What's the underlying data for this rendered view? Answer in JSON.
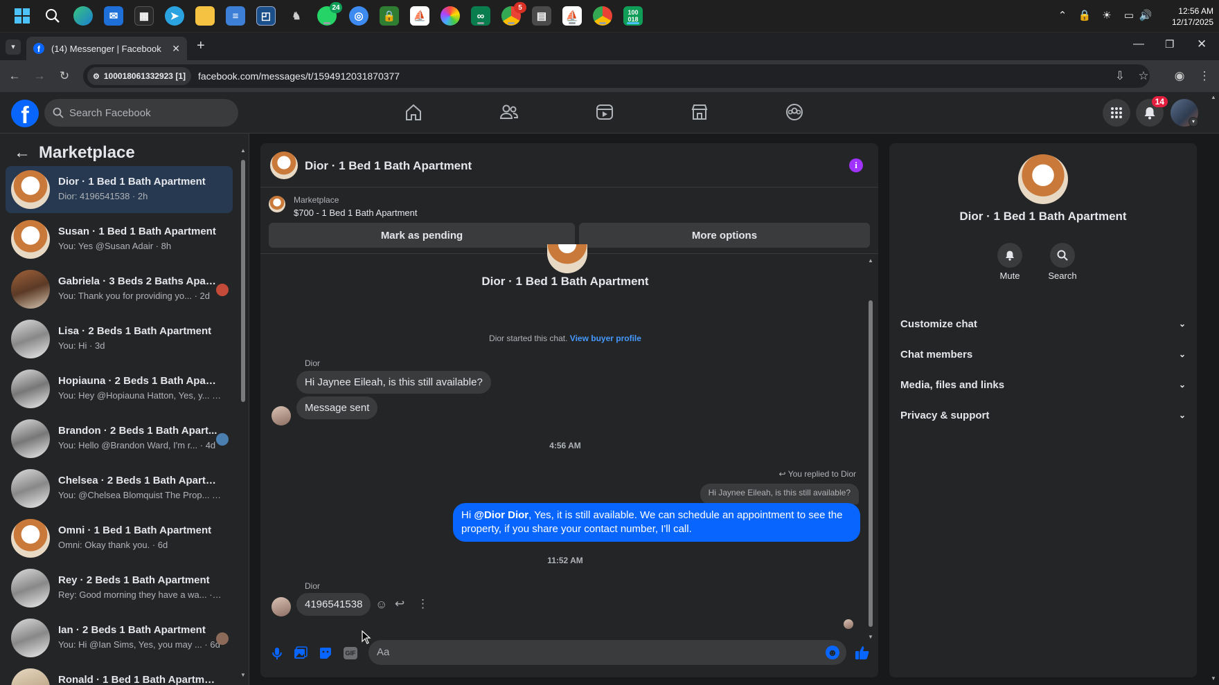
{
  "taskbar": {
    "whatsapp_badge": "24",
    "chrome_badge": "5",
    "clock_time": "12:56 AM",
    "clock_date": "12/17/2025",
    "app_badge_label": "100\n018"
  },
  "browser": {
    "tab_title": "(14) Messenger | Facebook",
    "site_chip": "100018061332923 [1]",
    "url": "facebook.com/messages/t/1594912031870377"
  },
  "fb": {
    "search_placeholder": "Search Facebook",
    "notifications_count": "14"
  },
  "sidebar": {
    "title": "Marketplace",
    "conversations": [
      {
        "title": "Dior · 1 Bed 1 Bath Apartment",
        "subtitle": "Dior: 4196541538 · 2h"
      },
      {
        "title": "Susan · 1 Bed 1 Bath Apartment",
        "subtitle": "You: Yes @Susan Adair · 8h"
      },
      {
        "title": "Gabriela · 3 Beds 2 Baths Apar...",
        "subtitle": "You: Thank you for providing yo...  · 2d"
      },
      {
        "title": "Lisa · 2 Beds 1 Bath Apartment",
        "subtitle": "You: Hi · 3d"
      },
      {
        "title": "Hopiauna · 2 Beds 1 Bath Apart...",
        "subtitle": "You: Hey @Hopiauna Hatton, Yes, y... · 4d"
      },
      {
        "title": "Brandon · 2 Beds 1 Bath Apart...",
        "subtitle": "You: Hello @Brandon Ward, I'm r... · 4d"
      },
      {
        "title": "Chelsea · 2 Beds 1 Bath Apartment",
        "subtitle": "You: @Chelsea Blomquist The Prop... · 5d"
      },
      {
        "title": "Omni · 1 Bed 1 Bath Apartment",
        "subtitle": "Omni: Okay thank you. · 6d"
      },
      {
        "title": "Rey · 2 Beds 1 Bath Apartment",
        "subtitle": "Rey: Good morning they have a wa... · 6d"
      },
      {
        "title": "Ian · 2 Beds 1 Bath Apartment",
        "subtitle": "You: Hi @Ian Sims, Yes, you may ... · 6d"
      },
      {
        "title": "Ronald · 1 Bed 1 Bath Apartment",
        "subtitle": ""
      }
    ]
  },
  "chat": {
    "header_title": "Dior · 1 Bed 1 Bath Apartment",
    "listing_label": "Marketplace",
    "listing_price": "$700 - 1 Bed 1 Bath Apartment",
    "mark_pending": "Mark as pending",
    "more_options": "More options",
    "intro_title": "Dior · 1 Bed 1 Bath Apartment",
    "started_text": "Dior started this chat.",
    "view_profile": "View buyer profile",
    "sender_name_1": "Dior",
    "msg_1": "Hi Jaynee Eileah, is this still available?",
    "msg_2": "Message sent",
    "time_1": "4:56 AM",
    "replied_to": "You replied to Dior",
    "quoted": "Hi Jaynee Eileah, is this still available?",
    "reply_prefix": "Hi ",
    "reply_mention": "@Dior Dior",
    "reply_text": ", Yes, it is still available. We can schedule an appointment to see the property, if you share your contact number, I'll call.",
    "time_2": "11:52 AM",
    "sender_name_2": "Dior",
    "msg_3": "4196541538",
    "composer_placeholder": "Aa"
  },
  "info": {
    "title": "Dior · 1 Bed 1 Bath Apartment",
    "mute_label": "Mute",
    "search_label": "Search",
    "sections": [
      "Customize chat",
      "Chat members",
      "Media, files and links",
      "Privacy & support"
    ]
  },
  "colors": {
    "accent": "#0866ff",
    "active_conv": "#263951",
    "info_icon": "#a033ff",
    "notification_badge": "#e41e3f"
  }
}
